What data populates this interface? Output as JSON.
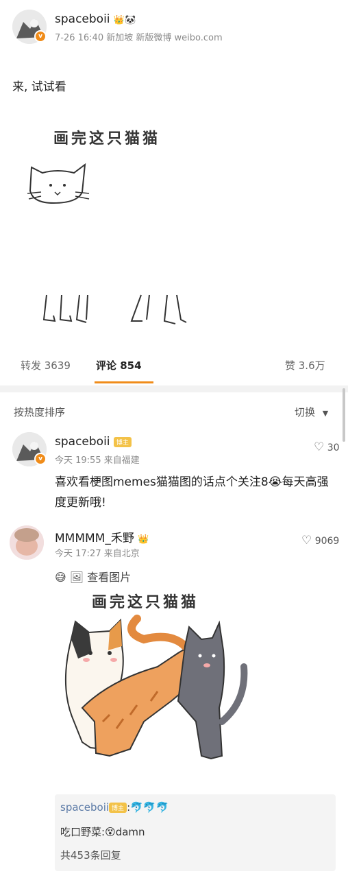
{
  "post": {
    "username": "spaceboii",
    "meta": "7-26 16:40 新加坡 新版微博 weibo.com",
    "text": "来, 试试看",
    "image_title": "画完这只猫猫"
  },
  "stats": {
    "repost": "转发 3639",
    "comments": "评论 854",
    "likes": "赞 3.6万"
  },
  "sort": {
    "label": "按热度排序",
    "switch": "切换"
  },
  "comments": [
    {
      "username": "spaceboii",
      "badge": "博主",
      "meta": "今天 19:55 来自福建",
      "likes": "30",
      "text": "喜欢看梗图memes猫猫图的话点个关注8😭每天高强度更新哦!"
    },
    {
      "username": "MMMMM_禾野",
      "meta": "今天 17:27 来自北京",
      "likes": "9069",
      "view_image": "查看图片",
      "image_title": "画完这只猫猫",
      "replies": [
        {
          "user": "spaceboii",
          "badge": "博主",
          "text": ":🐬🐬🐬"
        },
        {
          "user": "吃口野菜",
          "text": ":😵damn"
        }
      ],
      "reply_count": "共453条回复"
    }
  ],
  "colors": {
    "accent_orange": "#f08c1a",
    "badge_gold": "#f3c248",
    "reply_blue": "#5b7aa6"
  }
}
